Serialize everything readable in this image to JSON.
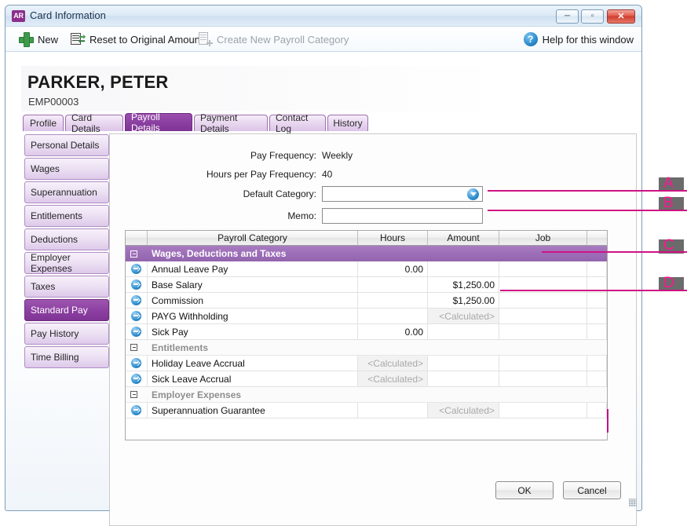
{
  "window": {
    "app_badge": "AR",
    "title": "Card Information",
    "minimize_label": "─",
    "maximize_label": "▫",
    "close_label": "✕"
  },
  "toolbar": {
    "new_label": "New",
    "reset_label": "Reset to Original Amount",
    "create_category_label": "Create New Payroll Category",
    "help_label": "Help for this window",
    "help_icon": "question-mark-circle-icon",
    "new_icon": "green-plus-icon",
    "reset_icon": "reset-document-icon",
    "create_icon": "new-document-icon"
  },
  "header": {
    "employee_name": "PARKER, PETER",
    "employee_id": "EMP00003"
  },
  "tabs": [
    {
      "label": "Profile",
      "accel": "P",
      "active": false
    },
    {
      "label": "Card Details",
      "accel": "D",
      "active": false
    },
    {
      "label": "Payroll Details",
      "accel": "a",
      "active": true
    },
    {
      "label": "Payment Details",
      "accel": "l",
      "active": false
    },
    {
      "label": "Contact Log",
      "accel": "g",
      "active": false
    },
    {
      "label": "History",
      "accel": "y",
      "active": false
    }
  ],
  "sidebar": {
    "items": [
      {
        "label": "Personal Details",
        "active": false
      },
      {
        "label": "Wages",
        "active": false
      },
      {
        "label": "Superannuation",
        "active": false
      },
      {
        "label": "Entitlements",
        "active": false
      },
      {
        "label": "Deductions",
        "active": false
      },
      {
        "label": "Employer Expenses",
        "active": false
      },
      {
        "label": "Taxes",
        "active": false
      },
      {
        "label": "Standard Pay",
        "active": true
      },
      {
        "label": "Pay History",
        "active": false
      },
      {
        "label": "Time Billing",
        "active": false
      }
    ]
  },
  "form": {
    "pay_frequency_label": "Pay Frequency:",
    "pay_frequency_value": "Weekly",
    "hours_label": "Hours per Pay Frequency:",
    "hours_value": "40",
    "default_category_label": "Default Category:",
    "default_category_value": "",
    "default_category_placeholder": "",
    "memo_label": "Memo:",
    "memo_value": "",
    "memo_placeholder": ""
  },
  "grid": {
    "columns": [
      "",
      "Payroll Category",
      "Hours",
      "Amount",
      "Job",
      ""
    ],
    "rows": [
      {
        "type": "group",
        "style": "primary",
        "label": "Wages, Deductions and Taxes"
      },
      {
        "type": "item",
        "category": "Annual Leave Pay",
        "hours": "0.00",
        "hours_calc": false,
        "amount": "",
        "amount_calc": false,
        "job": ""
      },
      {
        "type": "item",
        "category": "Base Salary",
        "hours": "",
        "hours_calc": false,
        "amount": "$1,250.00",
        "amount_calc": false,
        "job": ""
      },
      {
        "type": "item",
        "category": "Commission",
        "hours": "",
        "hours_calc": false,
        "amount": "$1,250.00",
        "amount_calc": false,
        "job": ""
      },
      {
        "type": "item",
        "category": "PAYG Withholding",
        "hours": "",
        "hours_calc": false,
        "amount": "<Calculated>",
        "amount_calc": true,
        "job": ""
      },
      {
        "type": "item",
        "category": "Sick Pay",
        "hours": "0.00",
        "hours_calc": false,
        "amount": "",
        "amount_calc": false,
        "job": ""
      },
      {
        "type": "group",
        "style": "secondary",
        "label": "Entitlements"
      },
      {
        "type": "item",
        "category": "Holiday Leave Accrual",
        "hours": "<Calculated>",
        "hours_calc": true,
        "amount": "",
        "amount_calc": false,
        "job": ""
      },
      {
        "type": "item",
        "category": "Sick Leave Accrual",
        "hours": "<Calculated>",
        "hours_calc": true,
        "amount": "",
        "amount_calc": false,
        "job": ""
      },
      {
        "type": "group",
        "style": "secondary",
        "label": "Employer Expenses"
      },
      {
        "type": "item",
        "category": "Superannuation Guarantee",
        "hours": "",
        "hours_calc": false,
        "amount": "<Calculated>",
        "amount_calc": true,
        "job": ""
      }
    ]
  },
  "footer": {
    "ok_label": "OK",
    "cancel_label": "Cancel"
  },
  "annotations": [
    {
      "id": "A",
      "label": "A",
      "target": "default-category-field"
    },
    {
      "id": "B",
      "label": "B",
      "target": "memo-field"
    },
    {
      "id": "C",
      "label": "C",
      "target": "wages-group-row"
    },
    {
      "id": "D",
      "label": "D",
      "target": "amount-column-selection"
    }
  ],
  "colors": {
    "accent_purple": "#8c3fa1",
    "group_purple": "#9d6eb8",
    "annotation_pink": "#cf1384",
    "annotation_letter": "#ff1493",
    "annotation_box": "#6b6b6b",
    "icon_blue": "#2f8fd0",
    "icon_green": "#3f9b4a",
    "close_red": "#cf3c2c"
  }
}
